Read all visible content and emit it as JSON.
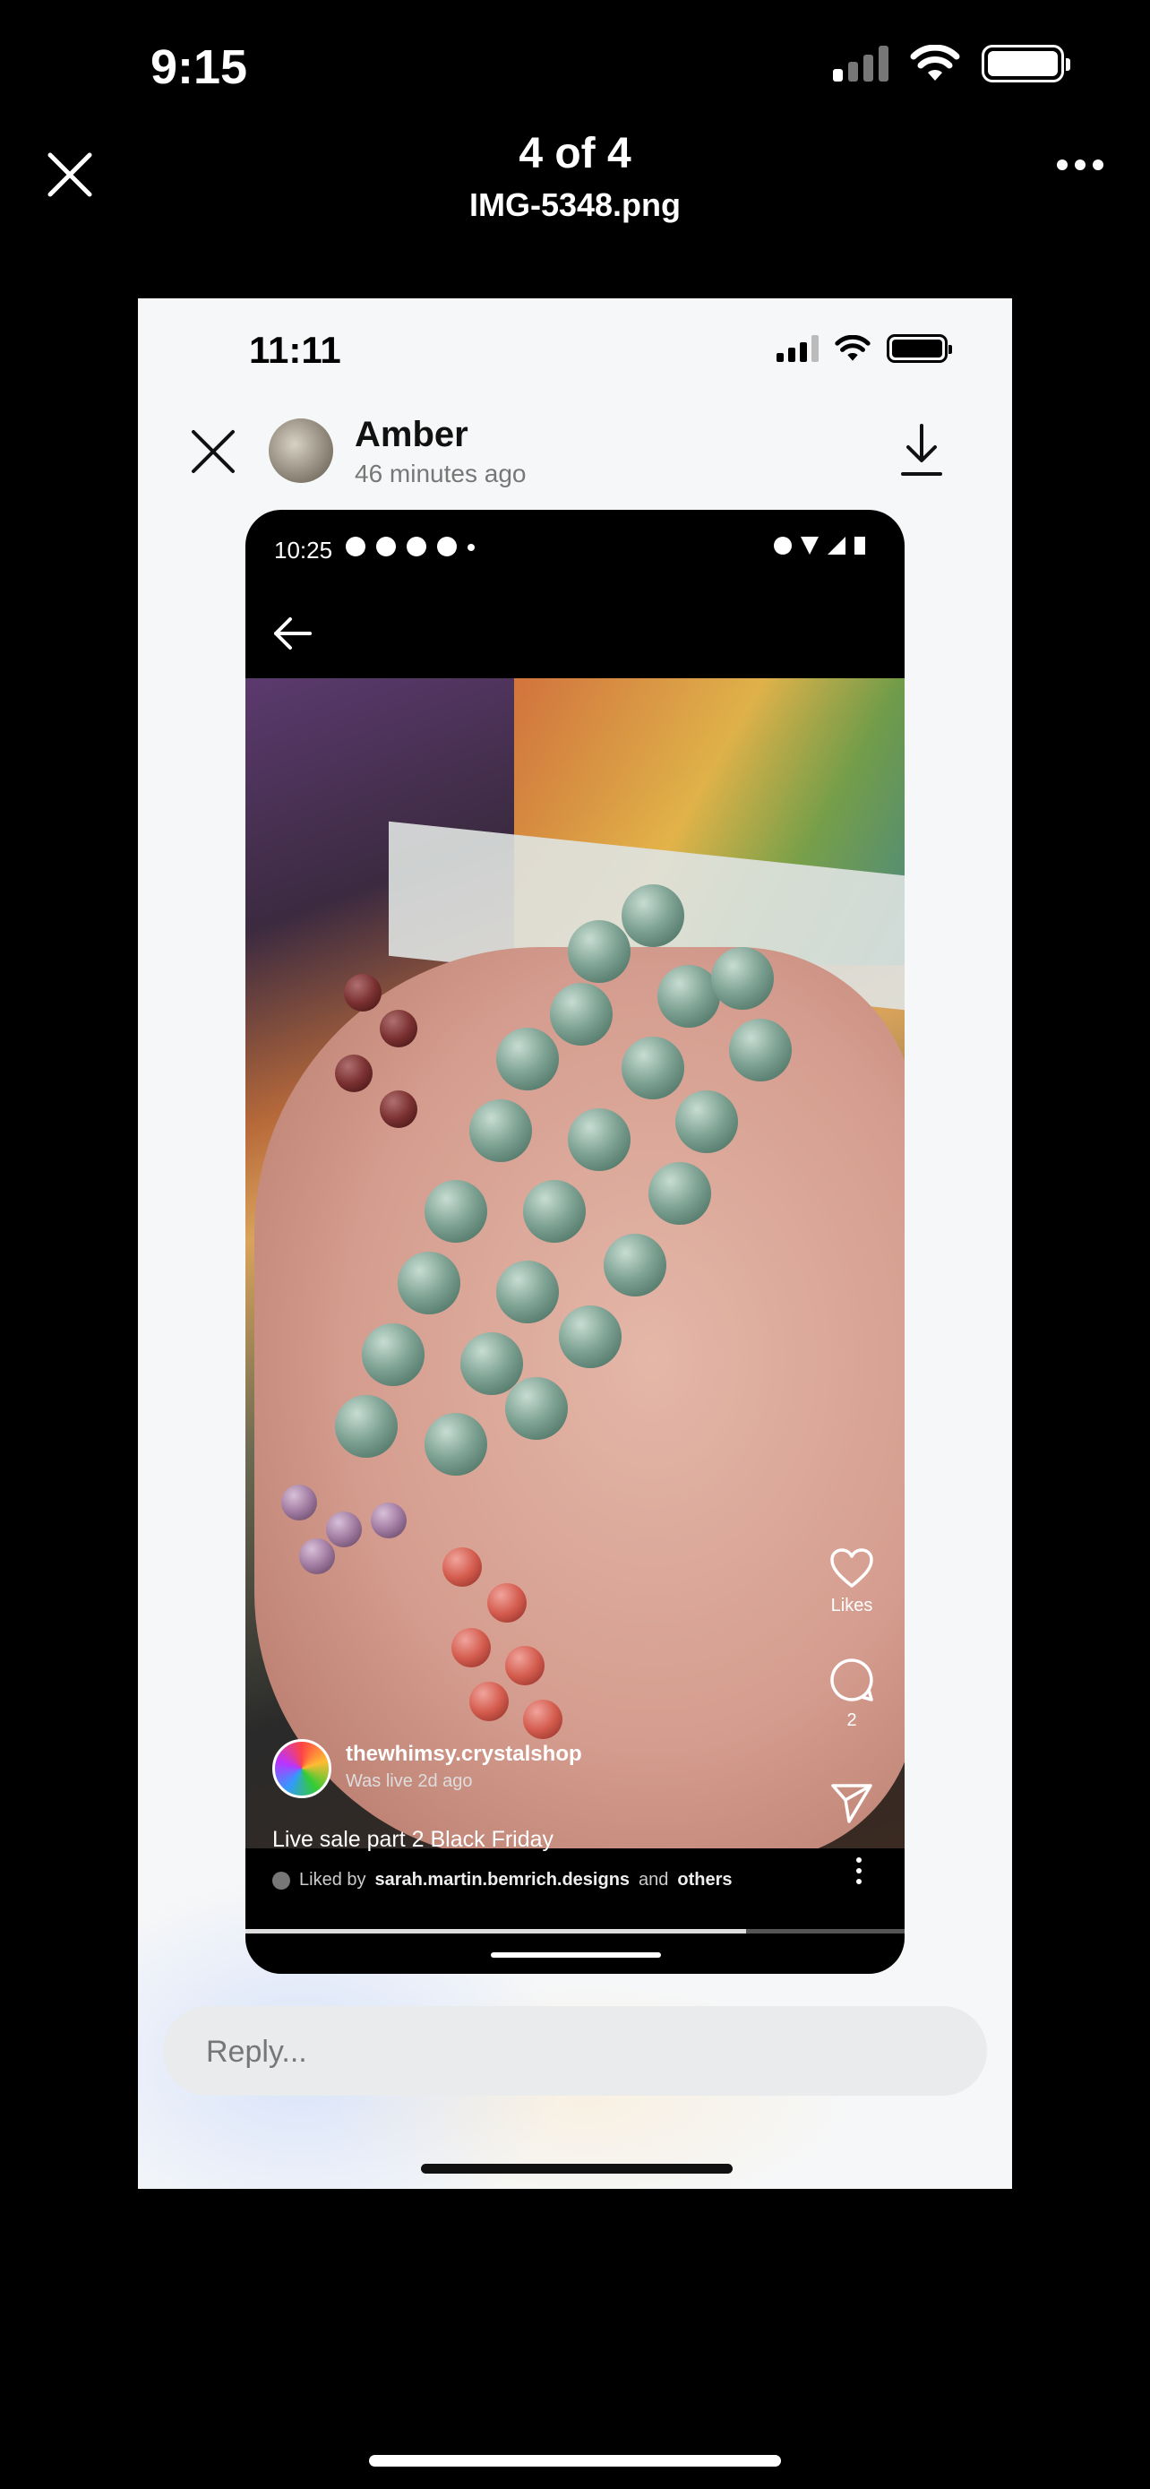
{
  "device": {
    "time": "9:15"
  },
  "viewer": {
    "title": "4 of 4",
    "filename": "IMG-5348.png"
  },
  "story": {
    "inner_time": "11:11",
    "user_name": "Amber",
    "posted_ago": "46 minutes ago",
    "reply_placeholder": "Reply..."
  },
  "inner_phone": {
    "time": "10:25",
    "account": "thewhimsy.crystalshop",
    "live_status": "Was live 2d ago",
    "caption": "Live sale part 2 Black Friday",
    "liked_by_prefix": "Liked by",
    "liked_by_user": "sarah.martin.bemrich.designs",
    "liked_by_and": "and",
    "liked_by_others": "others",
    "likes_label": "Likes",
    "comments_count": "2",
    "progress": 0.76
  }
}
